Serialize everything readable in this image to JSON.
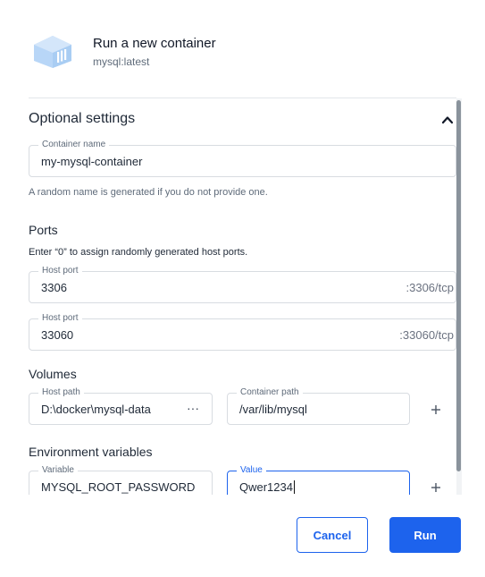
{
  "dialog": {
    "title": "Run a new container",
    "image": "mysql:latest",
    "logo_icon": "container-cube-icon"
  },
  "optional_settings": {
    "label": "Optional settings",
    "expanded": true,
    "container_name": {
      "label": "Container name",
      "value": "my-mysql-container",
      "helper": "A random name is generated if you do not provide one."
    },
    "ports": {
      "heading": "Ports",
      "description": "Enter “0” to assign randomly generated host ports.",
      "items": [
        {
          "label": "Host port",
          "value": "3306",
          "container_port": ":3306/tcp"
        },
        {
          "label": "Host port",
          "value": "33060",
          "container_port": ":33060/tcp"
        }
      ]
    },
    "volumes": {
      "heading": "Volumes",
      "host_path_label": "Host path",
      "host_path_value": "D:\\docker\\mysql-data",
      "browse_label": "···",
      "container_path_label": "Container path",
      "container_path_value": "/var/lib/mysql"
    },
    "env": {
      "heading": "Environment variables",
      "variable_label": "Variable",
      "variable_value": "MYSQL_ROOT_PASSWORD",
      "value_label": "Value",
      "value_value": "Qwer1234"
    }
  },
  "actions": {
    "cancel_label": "Cancel",
    "run_label": "Run"
  },
  "colors": {
    "accent": "#1d63ed",
    "logo": "#b8d6f7"
  }
}
